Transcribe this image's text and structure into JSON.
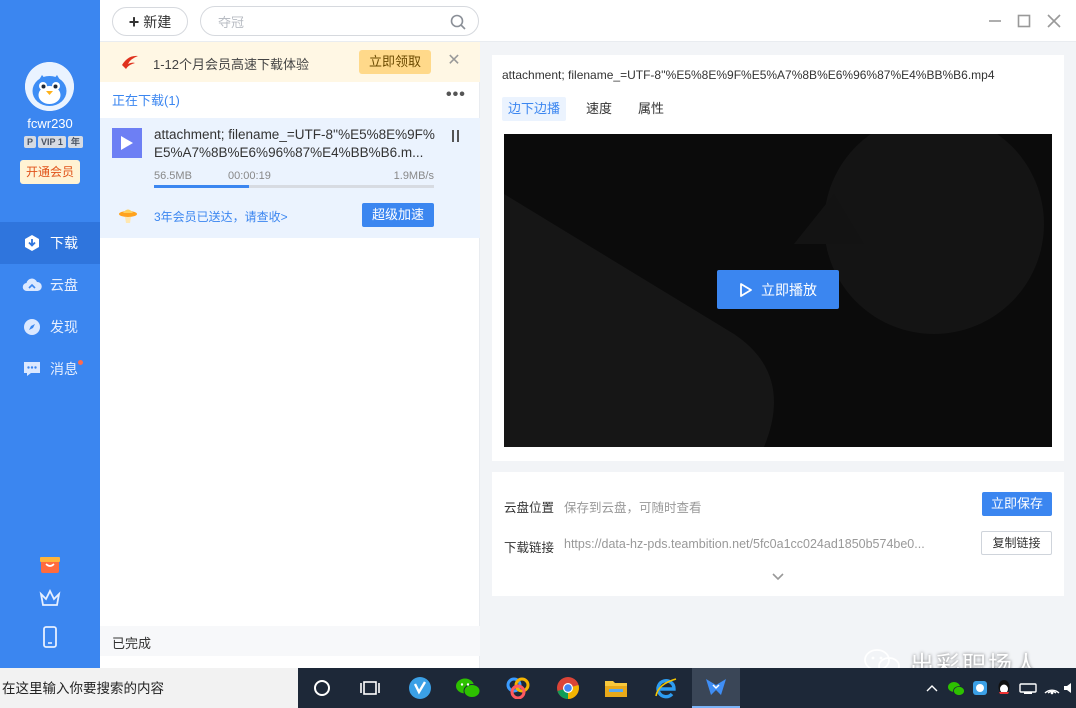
{
  "sidebar": {
    "username": "fcwr230",
    "vip_badges": [
      "P",
      "VIP 1",
      "年"
    ],
    "vip_button": "开通会员",
    "nav": [
      {
        "label": "下载",
        "icon": "download-icon"
      },
      {
        "label": "云盘",
        "icon": "cloud-icon"
      },
      {
        "label": "发现",
        "icon": "compass-icon"
      },
      {
        "label": "消息",
        "icon": "message-icon"
      }
    ]
  },
  "topbar": {
    "new_label": "新建",
    "search_placeholder": "夺冠"
  },
  "list": {
    "promo_text": "1-12个月会员高速下载体验",
    "promo_button": "立即领取",
    "downloading_header": "正在下载(1)",
    "task": {
      "name": "attachment; filename_=UTF-8''%E5%8E%9F%E5%A7%8B%E6%96%87%E4%BB%B6.m...",
      "size": "56.5MB",
      "elapsed": "00:00:19",
      "speed": "1.9MB/s",
      "progress": 0.34,
      "gift_text": "3年会员已送达，请查收>",
      "boost_button": "超级加速"
    },
    "completed_header": "已完成"
  },
  "detail": {
    "title": "attachment; filename_=UTF-8''%E5%8E%9F%E5%A7%8B%E6%96%87%E4%BB%B6.mp4",
    "tabs": [
      "边下边播",
      "速度",
      "属性"
    ],
    "play_button": "立即播放",
    "cloud_label": "云盘位置",
    "cloud_value": "保存到云盘，可随时查看",
    "save_button": "立即保存",
    "link_label": "下载链接",
    "link_value": "https://data-hz-pds.teambition.net/5fc0a1cc024ad1850b574be0...",
    "copy_button": "复制链接"
  },
  "taskbar": {
    "search_placeholder": "在这里输入你要搜索的内容"
  },
  "watermark": "出彩职场人",
  "colors": {
    "accent": "#3b86f0",
    "sidebar": "#3b86f0",
    "taskbar": "#1d2838"
  }
}
